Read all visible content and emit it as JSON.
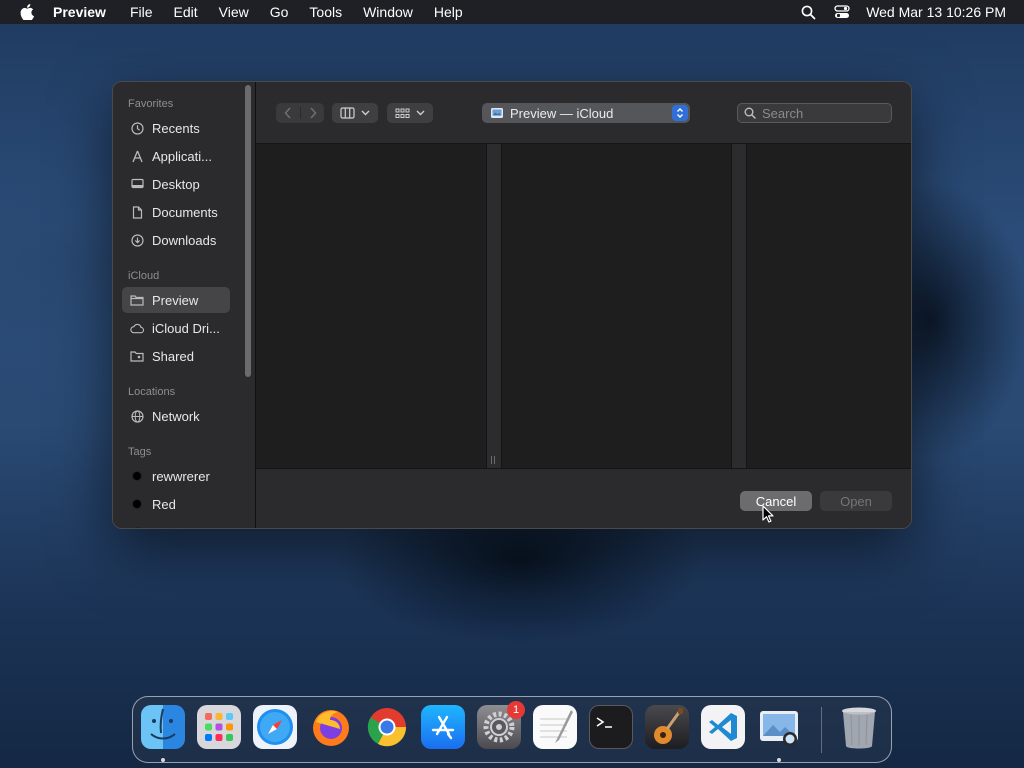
{
  "menubar": {
    "app_name": "Preview",
    "items": [
      "File",
      "Edit",
      "View",
      "Go",
      "Tools",
      "Window",
      "Help"
    ],
    "clock": "Wed Mar 13  10:26 PM",
    "icons": [
      "apple-icon",
      "spotlight-search-icon",
      "control-center-icon"
    ]
  },
  "dialog": {
    "sidebar": {
      "favorites_label": "Favorites",
      "favorites": [
        "Recents",
        "Applicati...",
        "Desktop",
        "Documents",
        "Downloads"
      ],
      "icloud_label": "iCloud",
      "icloud": [
        "Preview",
        "iCloud Dri...",
        "Shared"
      ],
      "locations_label": "Locations",
      "locations": [
        "Network"
      ],
      "tags_label": "Tags",
      "tags": [
        "rewwrerer",
        "Red"
      ]
    },
    "toolbar": {
      "location": "Preview — iCloud",
      "search_placeholder": "Search"
    },
    "footer": {
      "cancel_label": "Cancel",
      "open_label": "Open"
    }
  },
  "dock": {
    "apps": [
      "Finder",
      "Launchpad",
      "Safari",
      "Firefox",
      "Chrome",
      "App Store",
      "System Settings",
      "TextEdit",
      "Terminal",
      "GarageBand",
      "Visual Studio Code",
      "Preview",
      "Trash"
    ],
    "system_settings_badge": "1"
  },
  "colors": {
    "accent": "#2f6fd6",
    "badge": "#e53935"
  }
}
